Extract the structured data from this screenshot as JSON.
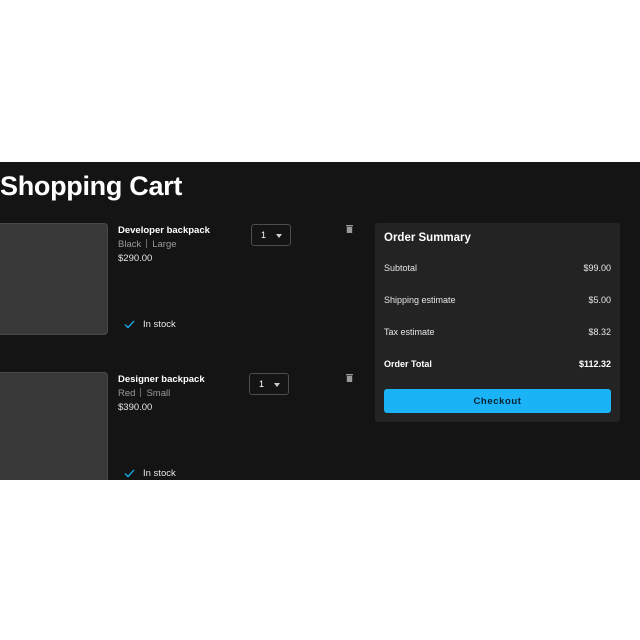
{
  "page": {
    "title": "Shopping Cart"
  },
  "cart": {
    "items": [
      {
        "name": "Developer backpack",
        "color": "Black",
        "size": "Large",
        "price": "$290.00",
        "quantity": "1",
        "stock_status": "In stock"
      },
      {
        "name": "Designer backpack",
        "color": "Red",
        "size": "Small",
        "price": "$390.00",
        "quantity": "1",
        "stock_status": "In stock"
      }
    ]
  },
  "summary": {
    "title": "Order Summary",
    "subtotal_label": "Subtotal",
    "subtotal_value": "$99.00",
    "shipping_label": "Shipping estimate",
    "shipping_value": "$5.00",
    "tax_label": "Tax estimate",
    "tax_value": "$8.32",
    "total_label": "Order Total",
    "total_value": "$112.32",
    "checkout_label": "Checkout"
  },
  "icons": {
    "stock": "check-icon",
    "remove": "trash-icon",
    "quantity_dropdown": "caret-down-icon"
  },
  "colors": {
    "background": "#141414",
    "card": "#232323",
    "accent": "#1ab3f5",
    "check": "#1ab3f5"
  }
}
